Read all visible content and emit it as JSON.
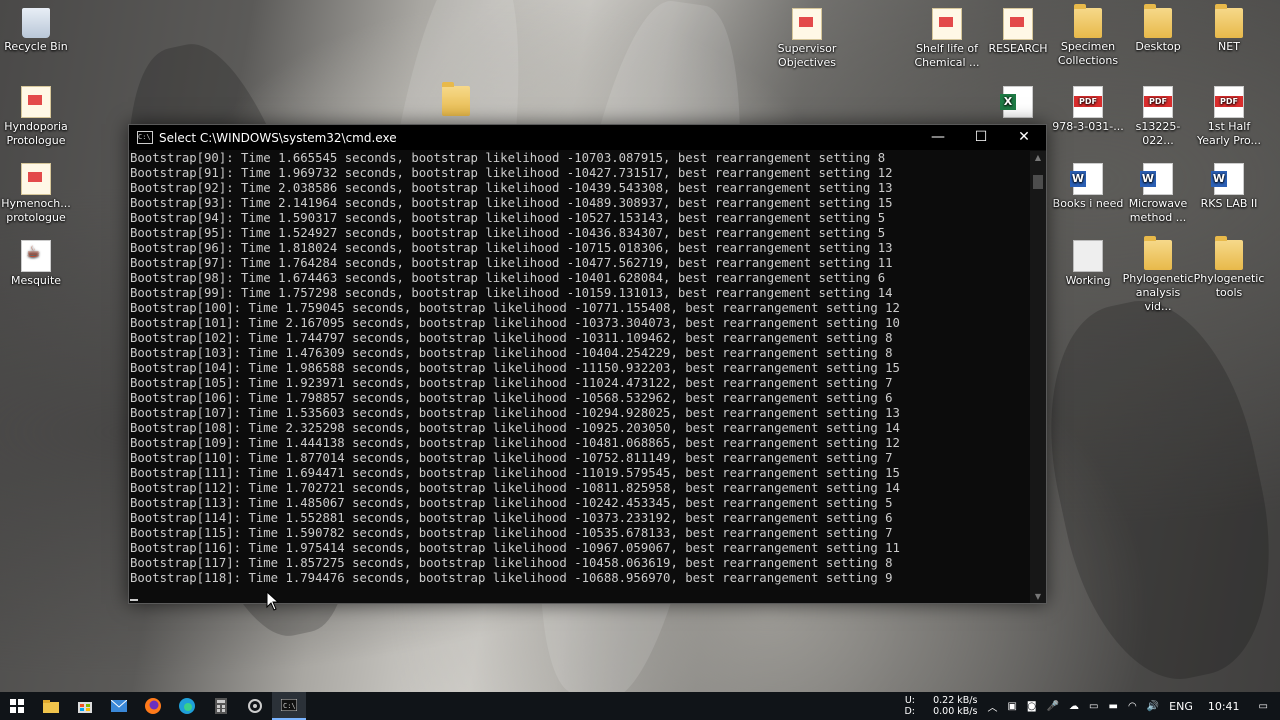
{
  "desktop": {
    "left_icons": [
      {
        "label": "Recycle Bin",
        "icon": "recycle-bin-icon"
      },
      {
        "label": "Hyndoporia Protologue",
        "icon": "document-icon"
      },
      {
        "label": "Hymenoch... protologue",
        "icon": "document-icon"
      },
      {
        "label": "Mesquite",
        "icon": "java-app-icon"
      }
    ],
    "right_icons": [
      {
        "label": "Supervisor Objectives",
        "icon": "document-icon"
      },
      {
        "label": "Shelf life of Chemical ...",
        "icon": "document-icon"
      },
      {
        "label": "RESEARCH",
        "icon": "document-icon"
      },
      {
        "label": "Specimen Collections",
        "icon": "folder-icon"
      },
      {
        "label": "Desktop",
        "icon": "folder-icon"
      },
      {
        "label": "NET",
        "icon": "folder-icon"
      },
      {
        "label": "978-3-031-...",
        "icon": "pdf-icon"
      },
      {
        "label": "s13225-022...",
        "icon": "pdf-icon"
      },
      {
        "label": "1st Half Yearly Pro...",
        "icon": "pdf-icon"
      },
      {
        "label": "Books i need",
        "icon": "word-icon"
      },
      {
        "label": "Microwave method ...",
        "icon": "word-icon"
      },
      {
        "label": "RKS LAB II",
        "icon": "word-icon"
      },
      {
        "label": "Working",
        "icon": "shortcut-icon"
      },
      {
        "label": "Phylogenetic analysis vid...",
        "icon": "folder-icon"
      },
      {
        "label": "Phylogenetic tools",
        "icon": "folder-icon"
      }
    ]
  },
  "window": {
    "title": "Select C:\\WINDOWS\\system32\\cmd.exe",
    "app_icon_text": "C:\\",
    "minimize": "—",
    "maximize": "☐",
    "close": "✕",
    "lines": [
      "Bootstrap[90]: Time 1.665545 seconds, bootstrap likelihood -10703.087915, best rearrangement setting 8",
      "Bootstrap[91]: Time 1.969732 seconds, bootstrap likelihood -10427.731517, best rearrangement setting 12",
      "Bootstrap[92]: Time 2.038586 seconds, bootstrap likelihood -10439.543308, best rearrangement setting 13",
      "Bootstrap[93]: Time 2.141964 seconds, bootstrap likelihood -10489.308937, best rearrangement setting 15",
      "Bootstrap[94]: Time 1.590317 seconds, bootstrap likelihood -10527.153143, best rearrangement setting 5",
      "Bootstrap[95]: Time 1.524927 seconds, bootstrap likelihood -10436.834307, best rearrangement setting 5",
      "Bootstrap[96]: Time 1.818024 seconds, bootstrap likelihood -10715.018306, best rearrangement setting 13",
      "Bootstrap[97]: Time 1.764284 seconds, bootstrap likelihood -10477.562719, best rearrangement setting 11",
      "Bootstrap[98]: Time 1.674463 seconds, bootstrap likelihood -10401.628084, best rearrangement setting 6",
      "Bootstrap[99]: Time 1.757298 seconds, bootstrap likelihood -10159.131013, best rearrangement setting 14",
      "Bootstrap[100]: Time 1.759045 seconds, bootstrap likelihood -10771.155408, best rearrangement setting 12",
      "Bootstrap[101]: Time 2.167095 seconds, bootstrap likelihood -10373.304073, best rearrangement setting 10",
      "Bootstrap[102]: Time 1.744797 seconds, bootstrap likelihood -10311.109462, best rearrangement setting 8",
      "Bootstrap[103]: Time 1.476309 seconds, bootstrap likelihood -10404.254229, best rearrangement setting 8",
      "Bootstrap[104]: Time 1.986588 seconds, bootstrap likelihood -11150.932203, best rearrangement setting 15",
      "Bootstrap[105]: Time 1.923971 seconds, bootstrap likelihood -11024.473122, best rearrangement setting 7",
      "Bootstrap[106]: Time 1.798857 seconds, bootstrap likelihood -10568.532962, best rearrangement setting 6",
      "Bootstrap[107]: Time 1.535603 seconds, bootstrap likelihood -10294.928025, best rearrangement setting 13",
      "Bootstrap[108]: Time 2.325298 seconds, bootstrap likelihood -10925.203050, best rearrangement setting 14",
      "Bootstrap[109]: Time 1.444138 seconds, bootstrap likelihood -10481.068865, best rearrangement setting 12",
      "Bootstrap[110]: Time 1.877014 seconds, bootstrap likelihood -10752.811149, best rearrangement setting 7",
      "Bootstrap[111]: Time 1.694471 seconds, bootstrap likelihood -11019.579545, best rearrangement setting 15",
      "Bootstrap[112]: Time 1.702721 seconds, bootstrap likelihood -10811.825958, best rearrangement setting 14",
      "Bootstrap[113]: Time 1.485067 seconds, bootstrap likelihood -10242.453345, best rearrangement setting 5",
      "Bootstrap[114]: Time 1.552881 seconds, bootstrap likelihood -10373.233192, best rearrangement setting 6",
      "Bootstrap[115]: Time 1.590782 seconds, bootstrap likelihood -10535.678133, best rearrangement setting 7",
      "Bootstrap[116]: Time 1.975414 seconds, bootstrap likelihood -10967.059067, best rearrangement setting 11",
      "Bootstrap[117]: Time 1.857275 seconds, bootstrap likelihood -10458.063619, best rearrangement setting 8",
      "Bootstrap[118]: Time 1.794476 seconds, bootstrap likelihood -10688.956970, best rearrangement setting 9"
    ]
  },
  "taskbar": {
    "start_icon": "windows-start-icon",
    "apps": [
      "file-explorer-icon",
      "store-icon",
      "mail-icon",
      "firefox-icon",
      "edge-icon",
      "calculator-icon",
      "settings-icon",
      "cmd-icon"
    ],
    "net_up_label": "U:",
    "net_down_label": "D:",
    "net_up": "0.22 kB/s",
    "net_down": "0.00 kB/s",
    "language": "ENG",
    "time": "10:41"
  },
  "colors": {
    "console_bg": "#0c0c0c",
    "console_text": "#cccccc",
    "taskbar_bg": "#101418"
  }
}
